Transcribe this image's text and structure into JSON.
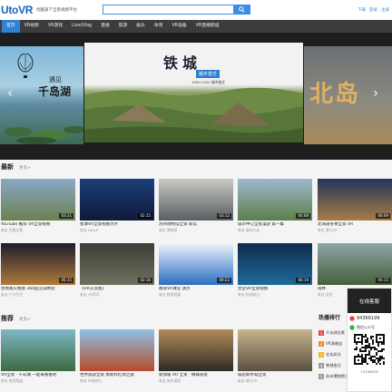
{
  "header": {
    "logo": "UtoVR",
    "slogan": "优酷旗下全景视频平台",
    "search_placeholder": "",
    "links": [
      "下载",
      "登录",
      "注册"
    ]
  },
  "nav": {
    "items": [
      "首页",
      "VR视频",
      "VR游戏",
      "Live/Vlog",
      "直播",
      "旅游",
      "娱乐",
      "体育",
      "VR设备",
      "VR直播频道"
    ]
  },
  "banner": {
    "left": {
      "sub": "遇见",
      "main": "千岛湖"
    },
    "center": {
      "title": "铁城",
      "tag": "城乡变迁",
      "small": "1950-2020 城市变迁"
    },
    "right": {
      "big": "北岛"
    }
  },
  "latest": {
    "title": "最新",
    "more": "更多>",
    "cards": [
      {
        "title": "YouTube 推荐 VR全景视频",
        "meta": "来自 优酷全景",
        "duration": "03:21",
        "colors": [
          "#8aa9c6",
          "#6b8050"
        ]
      },
      {
        "title": "星球VR全景视频大片",
        "meta": "来自 UtoVR",
        "duration": "02:15",
        "colors": [
          "#1c3e7a",
          "#101a3a"
        ]
      },
      {
        "title": "苏州博物馆全景 新馆",
        "meta": "来自 博物馆",
        "duration": "03:12",
        "colors": [
          "#c9c9c5",
          "#5a5f62"
        ]
      },
      {
        "title": "城市中心全景漫游 第一集",
        "meta": "来自 城市行走",
        "duration": "04:08",
        "colors": [
          "#9db8cf",
          "#5c7f4a"
        ]
      },
      {
        "title": "北海道冬季全景 VR",
        "meta": "来自 旅行VR",
        "duration": "06:09",
        "colors": [
          "#24345a",
          "#a87b48"
        ]
      },
      {
        "title": "营地篝火晚会 360度沉浸体验",
        "meta": "来自 户外生活",
        "duration": "05:15",
        "colors": [
          "#1b1d2c",
          "#b07a3a"
        ]
      },
      {
        "title": "《VR交流会》",
        "meta": "来自 VR资讯",
        "duration": "02:16",
        "colors": [
          "#3b3f3a",
          "#6f705c"
        ]
      },
      {
        "title": "教育VR课堂 演示",
        "meta": "来自 教育频道",
        "duration": "09:22",
        "colors": [
          "#eef3fb",
          "#2c6fc2"
        ]
      },
      {
        "title": "太空VR全景视频",
        "meta": "来自 科技前沿",
        "duration": "06:19",
        "colors": [
          "#0f2c4c",
          "#1e6a9a"
        ]
      },
      {
        "title": "雨林",
        "meta": "来自 自然",
        "duration": "05:15",
        "colors": [
          "#8fa4a8",
          "#46603a"
        ]
      }
    ]
  },
  "recommend": {
    "title": "推荐",
    "more": "更多>",
    "cards": [
      {
        "title": "VR全景 · 千岛湖 一起来看看吧",
        "meta": "来自 旅游频道",
        "duration": "",
        "colors": [
          "#7fb7c9",
          "#3d6a3e"
        ]
      },
      {
        "title": "世界旅游全景 莫斯科红场之旅",
        "meta": "来自 环球旅行",
        "duration": "",
        "colors": [
          "#8fc2e6",
          "#b34c2c"
        ]
      },
      {
        "title": "新加坡 VR 全景 · 狮城夜景",
        "meta": "来自 城市漫游",
        "duration": "",
        "colors": [
          "#b28d5a",
          "#2e2a26"
        ]
      },
      {
        "title": "威尼斯水城全景",
        "meta": "来自 旅行VR",
        "duration": "",
        "colors": [
          "#c9b48f",
          "#5a5042"
        ]
      }
    ]
  },
  "hot": {
    "title": "热播排行",
    "items": [
      {
        "num": "1",
        "text": "千岛湖全景",
        "color": "#e8453c"
      },
      {
        "num": "2",
        "text": "VR演唱会",
        "color": "#f08a24"
      },
      {
        "num": "3",
        "text": "北岛风光",
        "color": "#f2b221"
      },
      {
        "num": "4",
        "text": "铁城变迁",
        "color": "#9a9a9a"
      },
      {
        "num": "5",
        "text": "苏州博物馆全景",
        "color": "#9a9a9a"
      }
    ]
  },
  "float": {
    "head": "在线客服",
    "qq": "94366199",
    "wechat": "微信公众号",
    "phone": "12345678"
  }
}
